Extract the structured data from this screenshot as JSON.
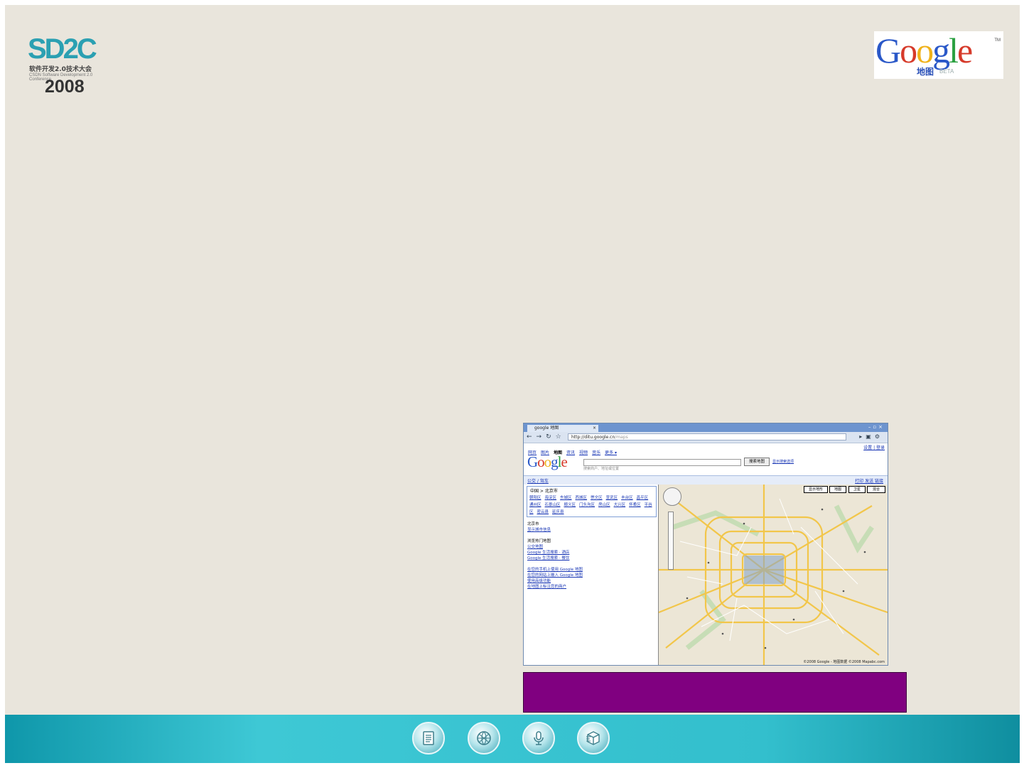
{
  "logos": {
    "sd2c": {
      "mark": "SD2C",
      "subtitle_zh": "软件开发2.0技术大会",
      "subtitle_en": "CSDN Software Development 2.0 Conference",
      "year": "2008"
    },
    "google_maps": {
      "wordmark": "Google",
      "tm": "TM",
      "zh": "地图",
      "beta": "BETA"
    }
  },
  "screenshot": {
    "tab_title": "google 地图",
    "url_host": "http://ditu.google.cn",
    "url_path": "/maps",
    "top_nav": [
      "网页",
      "图片",
      "地图",
      "资讯",
      "视频",
      "音乐",
      "更多 ▾"
    ],
    "selected_nav": "地图",
    "account_links": "设置 | 登录",
    "logo_word": "Google",
    "search_hint": "搜索商户、地址或位置",
    "search_button": "搜索地图",
    "search_link": "显示搜索选项",
    "left_link": "公交 / 驾车",
    "right_links": "打印  发送  链接",
    "city_crumb": "中国 > 北京市",
    "districts": [
      "朝阳区",
      "海淀区",
      "东城区",
      "西城区",
      "崇文区",
      "宣武区",
      "丰台区",
      "昌平区",
      "通州区",
      "石景山区",
      "顺义区",
      "门头沟区",
      "房山区",
      "大兴区",
      "怀柔区",
      "平谷区",
      "密云县",
      "延庆县"
    ],
    "info_title": "北京市",
    "info_lines": [
      "显示城市信息",
      "",
      "浏览热门地图",
      "公交地图",
      "Google 生活搜索 · 酒店",
      "Google 生活搜索 · 餐饮",
      "",
      "在您的手机上使用 Google 地图",
      "在您的网站上嵌入 Google 地图",
      "使用高级功能",
      "在地图上标注您的商户"
    ],
    "map_types": [
      "显示地形",
      "地图",
      "卫星",
      "混合"
    ],
    "map_copyright": "©2008 Google - 地图数据 ©2008 Mapabc.com"
  },
  "bottom_bar": {
    "icons": [
      "document-icon",
      "globe-icon",
      "microphone-icon",
      "cube-icon"
    ]
  },
  "colors": {
    "slide_bg": "#e9e5dc",
    "caption_bg": "#800080",
    "bar_teal": "#33bfcd"
  }
}
